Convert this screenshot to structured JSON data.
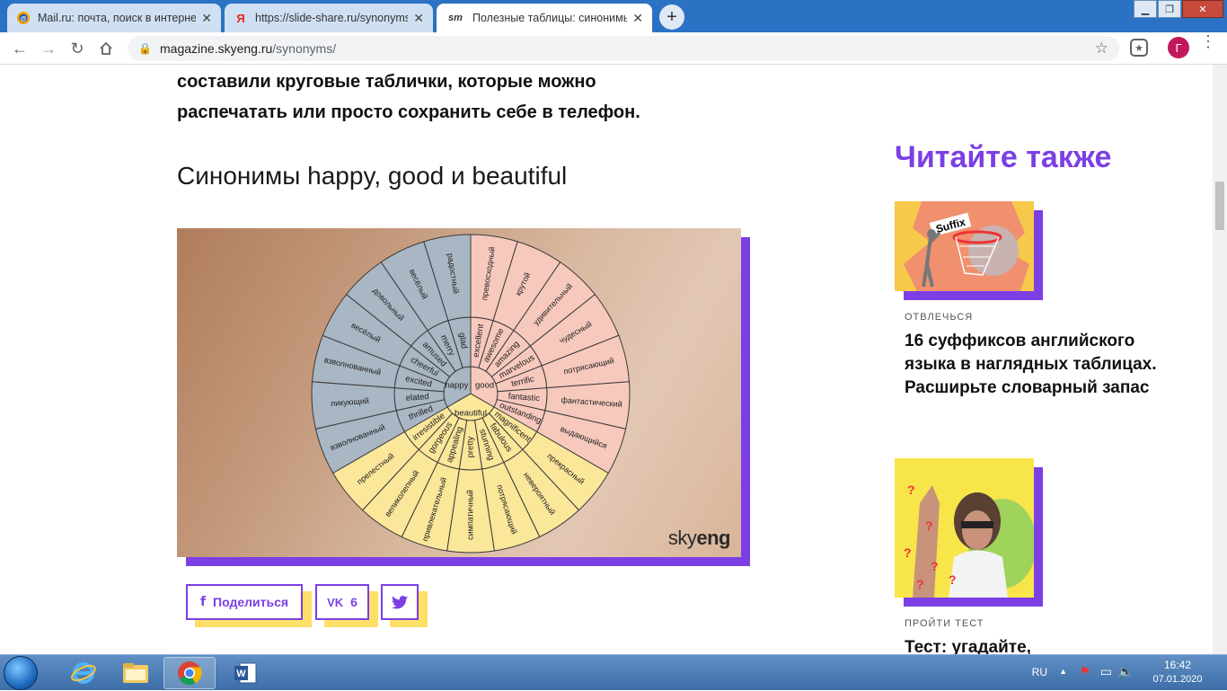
{
  "tabs": [
    {
      "title": "Mail.ru: почта, поиск в интернете",
      "icon": "mailru-icon"
    },
    {
      "title": "https://slide-share.ru/synonyms-",
      "icon": "yandex-icon"
    },
    {
      "title": "Полезные таблицы: синонимы",
      "icon": "skyeng-icon",
      "fav_text": "sm"
    }
  ],
  "address": {
    "domain": "magazine.skyeng.ru",
    "path": "/synonyms/"
  },
  "profile_initial": "Г",
  "article": {
    "intro_line1": "составили круговые таблички, которые можно",
    "intro_line2": "распечатать или просто сохранить себе в телефон.",
    "heading": "Синонимы happy, good и beautiful",
    "brand_light": "sky",
    "brand_bold": "eng"
  },
  "wheel": {
    "center": {
      "happy": "happy",
      "good": "good",
      "beautiful": "beautiful"
    },
    "happy_mid": [
      "glad",
      "merry",
      "amused",
      "cheerful",
      "excited",
      "elated",
      "thrilled"
    ],
    "happy_outer": [
      "радостный",
      "весёлый",
      "довольный",
      "весёлый",
      "взволнованный",
      "ликующий",
      "взволнованный"
    ],
    "good_mid": [
      "excellent",
      "awesome",
      "amazing",
      "marvelous",
      "terrific",
      "fantastic",
      "outstanding"
    ],
    "good_outer": [
      "превосходный",
      "крутой",
      "удивительный",
      "чудесный",
      "потрясающий",
      "фантастический",
      "выдающийся"
    ],
    "beautiful_mid": [
      "magnificent",
      "fabulous",
      "stunning",
      "pretty",
      "appealing",
      "gorgeous",
      "irresistible"
    ],
    "beautiful_outer": [
      "прекрасный",
      "невероятный",
      "потрясающий",
      "симпатичный",
      "привлекательный",
      "великолепный",
      "прелестный"
    ],
    "colors": {
      "happy": "#a9b6c3",
      "good": "#f7c9bd",
      "beautiful": "#fbe79a",
      "line": "#3a3a3a"
    }
  },
  "share": {
    "share_label": "Поделиться",
    "vk_count": "6"
  },
  "aside": {
    "title": "Читайте также",
    "cards": [
      {
        "category": "ОТВЛЕЧЬСЯ",
        "title": "16 суффиксов английского языка в наглядных таблицах. Расширьте словарный запас",
        "img_text": "Suffix"
      },
      {
        "category": "ПРОЙТИ ТЕСТ",
        "title": "Тест: угадайте,"
      }
    ]
  },
  "taskbar": {
    "lang": "RU",
    "time": "16:42",
    "date": "07.01.2020"
  },
  "colors": {
    "accent": "#7b3fe4",
    "yellow": "#ffe066",
    "tabbar": "#2b72c4"
  }
}
